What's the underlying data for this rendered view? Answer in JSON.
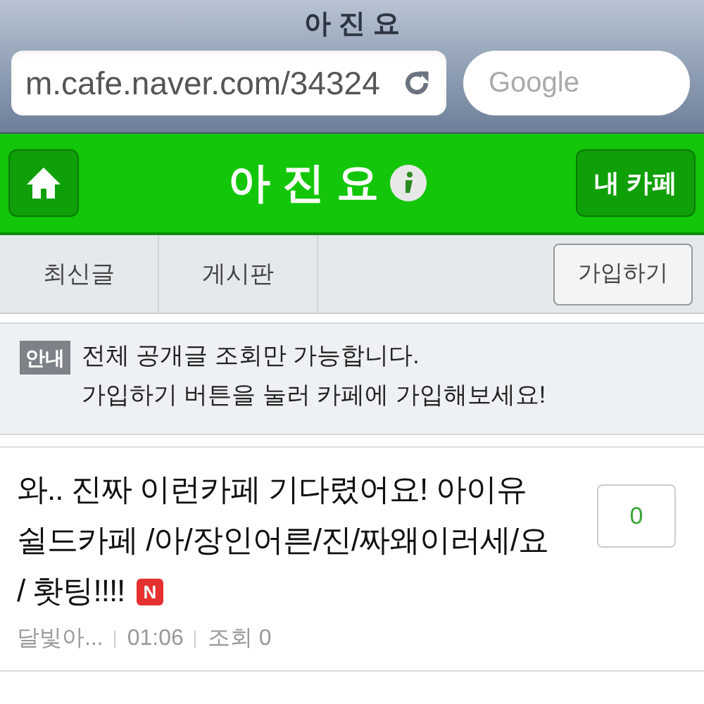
{
  "browser": {
    "title": "아 진 요",
    "url": "m.cafe.naver.com/34324",
    "search": {
      "placeholder": "Google"
    }
  },
  "header": {
    "title": "아 진 요",
    "my_cafe_button": "내 카페"
  },
  "tabs": [
    {
      "label": "최신글"
    },
    {
      "label": "게시판"
    }
  ],
  "join_button": "가입하기",
  "notice": {
    "badge": "안내",
    "lines": [
      "전체 공개글 조회만 가능합니다.",
      "가입하기 버튼을 눌러 카페에 가입해보세요!"
    ]
  },
  "posts": [
    {
      "title_lines": [
        "와.. 진짜 이런카페 기다렸어요! 아이유",
        "쉴드카페 /아/장인어른/진/짜왜이러세/요",
        "/ 홧팅!!!!"
      ],
      "new_badge": "N",
      "author": "달빛아...",
      "time": "01:06",
      "views": "조회 0",
      "comments": "0"
    }
  ]
}
